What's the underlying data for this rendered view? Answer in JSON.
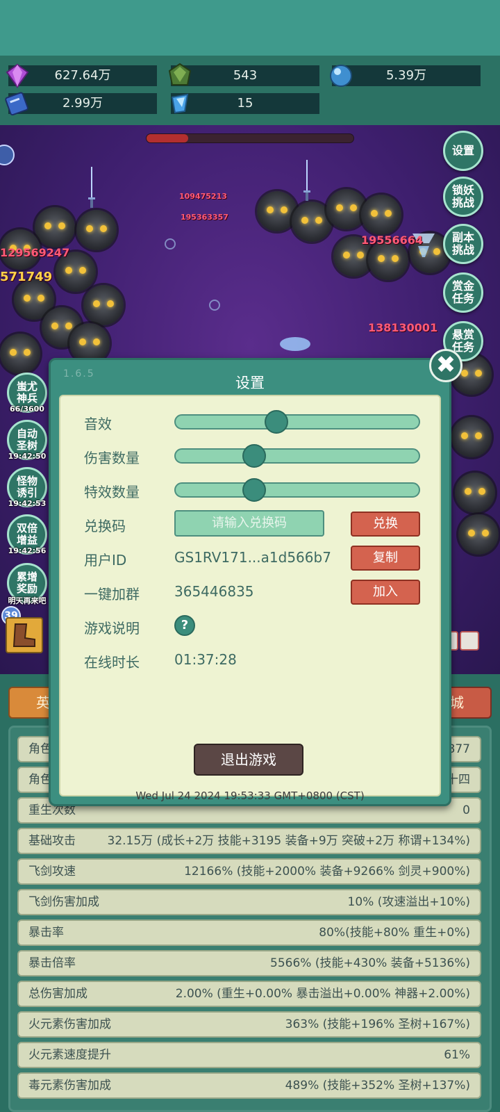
{
  "resources": [
    {
      "icon": "purple-gem-icon",
      "value": "627.64万"
    },
    {
      "icon": "green-crystal-icon",
      "value": "543"
    },
    {
      "icon": "blue-orb-icon",
      "value": "5.39万"
    },
    {
      "icon": "blue-book-icon",
      "value": "2.99万"
    },
    {
      "icon": "blue-shard-icon",
      "value": "15"
    }
  ],
  "boss_hp_fraction": 0.2,
  "side_buttons": [
    {
      "label": "设置"
    },
    {
      "label": "锁妖挑战"
    },
    {
      "label": "副本挑战"
    },
    {
      "label": "赏金任务"
    },
    {
      "label": "悬赏任务"
    }
  ],
  "left_buttons": [
    {
      "label": "蚩尤神兵",
      "caption": "66/3600"
    },
    {
      "label": "自动圣树",
      "caption": "19:42:50"
    },
    {
      "label": "怪物诱引",
      "caption": "19:42:53"
    },
    {
      "label": "双倍增益",
      "caption": "19:42:56"
    },
    {
      "label": "累增奖励",
      "caption": "明天再来吧"
    }
  ],
  "equip_level": "39",
  "damage_numbers": [
    "109475213",
    "19556664",
    "571749",
    "129569247",
    "138130001",
    "195363357"
  ],
  "tabs": {
    "left": "英",
    "right": "城"
  },
  "stats_partial": [
    {
      "key": "角色",
      "value": "877"
    },
    {
      "key": "角色",
      "value": "十四"
    },
    {
      "key": "重生次数",
      "value": "0"
    }
  ],
  "stats": [
    {
      "key": "基础攻击",
      "value": "32.15万 (成长+2万 技能+3195 装备+9万 突破+2万 称谓+134%)"
    },
    {
      "key": "飞剑攻速",
      "value": "12166% (技能+2000% 装备+9266% 剑灵+900%)"
    },
    {
      "key": "飞剑伤害加成",
      "value": "10% (攻速溢出+10%)"
    },
    {
      "key": "暴击率",
      "value": "80%(技能+80% 重生+0%)"
    },
    {
      "key": "暴击倍率",
      "value": "5566% (技能+430% 装备+5136%)"
    },
    {
      "key": "总伤害加成",
      "value": "2.00% (重生+0.00% 暴击溢出+0.00% 神器+2.00%)"
    },
    {
      "key": "火元素伤害加成",
      "value": "363% (技能+196% 圣树+167%)"
    },
    {
      "key": "火元素速度提升",
      "value": "61%"
    },
    {
      "key": "毒元素伤害加成",
      "value": "489% (技能+352% 圣树+137%)"
    }
  ],
  "dialog": {
    "title": "设置",
    "version": "1.6.5",
    "close_glyph": "✖",
    "sound_label": "音效",
    "sound_level": 0.4,
    "damage_count_label": "伤害数量",
    "damage_count_level": 0.3,
    "effect_count_label": "特效数量",
    "effect_count_level": 0.3,
    "redeem_label": "兑换码",
    "redeem_placeholder": "请输入兑换码",
    "redeem_button": "兑换",
    "user_id_label": "用户ID",
    "user_id_value": "GS1RV171...a1d566b7",
    "copy_button": "复制",
    "group_label": "一键加群",
    "group_value": "365446835",
    "join_button": "加入",
    "guide_label": "游戏说明",
    "guide_icon": "?",
    "online_label": "在线时长",
    "online_value": "01:37:28",
    "quit_button": "退出游戏",
    "timestamp": "Wed Jul 24 2024 19:53:33 GMT+0800 (CST)"
  }
}
